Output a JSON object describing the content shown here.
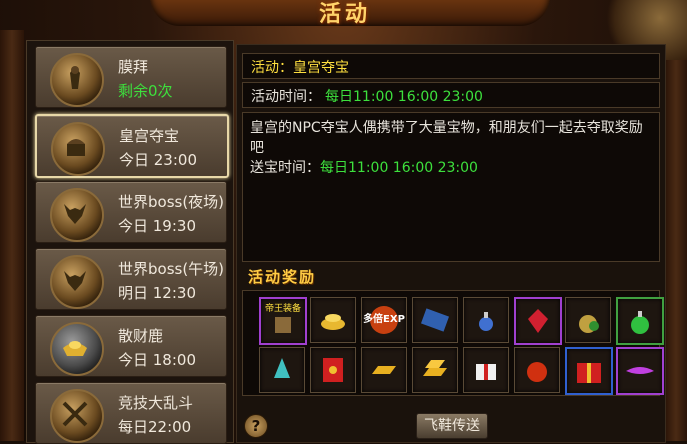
{
  "window": {
    "title": "活动"
  },
  "activities": [
    {
      "name": "膜拜",
      "sub": "剩余0次",
      "sub_green": true,
      "icon": "statue-icon"
    },
    {
      "name": "皇宫夺宝",
      "sub": "今日 23:00",
      "selected": true,
      "icon": "treasure-icon"
    },
    {
      "name": "世界boss(夜场)",
      "sub": "今日 19:30",
      "icon": "demon-icon"
    },
    {
      "name": "世界boss(午场)",
      "sub": "明日 12:30",
      "icon": "demon-icon"
    },
    {
      "name": "散财鹿",
      "sub": "今日 18:00",
      "icon": "gold-ingot-icon"
    },
    {
      "name": "竞技大乱斗",
      "sub": "每日22:00",
      "icon": "crossed-swords-icon"
    }
  ],
  "detail": {
    "activity_label": "活动：",
    "activity_name": "皇宫夺宝",
    "time_label": "活动时间：",
    "time_value": "每日11:00 16:00 23:00",
    "description": "皇宫的NPC夺宝人偶携带了大量宝物，和朋友们一起去夺取奖励吧",
    "deliver_label": "送宝时间：",
    "deliver_value": "每日11:00 16:00 23:00"
  },
  "rewards": {
    "title": "活动奖励",
    "items": [
      {
        "icon": "king-equipment-icon",
        "label": "帝王装备",
        "border": "purple"
      },
      {
        "icon": "gold-coins-icon"
      },
      {
        "icon": "multi-exp-icon",
        "label": "多倍EXP"
      },
      {
        "icon": "book-icon"
      },
      {
        "icon": "potion-icon"
      },
      {
        "icon": "red-gem-icon",
        "border": "purple"
      },
      {
        "icon": "money-bag-icon"
      },
      {
        "icon": "green-potion-icon",
        "border": "green"
      },
      {
        "icon": "crystal-icon"
      },
      {
        "icon": "red-envelope-icon"
      },
      {
        "icon": "gold-bar-icon"
      },
      {
        "icon": "gold-bars-icon"
      },
      {
        "icon": "gift-box-icon"
      },
      {
        "icon": "lucky-bag-icon"
      },
      {
        "icon": "red-gift-box-icon",
        "border": "blue"
      },
      {
        "icon": "purple-wing-icon",
        "border": "purple"
      }
    ]
  },
  "buttons": {
    "teleport": "飞鞋传送",
    "help": "?"
  },
  "colors": {
    "highlight": "#ffe040",
    "green": "#3de03d",
    "text": "#e8e4dc"
  }
}
